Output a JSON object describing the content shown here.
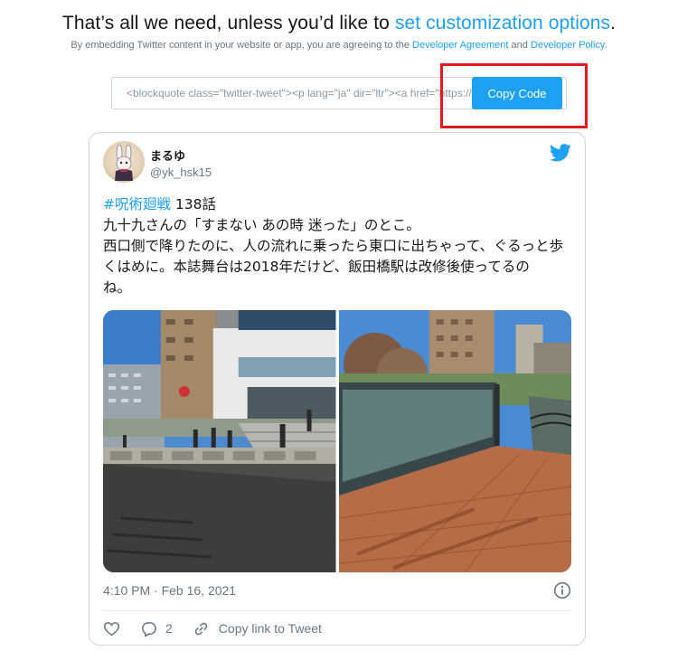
{
  "header": {
    "headline_prefix": "That’s all we need, unless you’d like to ",
    "headline_link": "set customization options",
    "headline_suffix": ".",
    "sub_prefix": "By embedding Twitter content in your website or app, you are agreeing to the ",
    "developer_agreement": "Developer Agreement",
    "sub_and": " and ",
    "developer_policy": "Developer Policy",
    "sub_suffix": "."
  },
  "embed": {
    "code_preview": "<blockquote class=\"twitter-tweet\"><p lang=\"ja\" dir=\"ltr\"><a href=\"https://twitter.com/hashtag/",
    "copy_label": "Copy Code"
  },
  "tweet": {
    "author_name": "まるゆ",
    "author_handle": "@yk_hsk15",
    "hashtag": "#呪術廻戦",
    "hashtag_rest": " 138話",
    "lines": [
      "九十九さんの「すまない あの時 迷った」のとこ。",
      "西口側で降りたのに、人の流れに乗ったら東口に出ちゃって、ぐるっと歩",
      "くはめに。本誌舞台は2018年だけど、飯田橋駅は改修後使ってるの",
      "ね。"
    ],
    "timestamp": "4:10 PM · Feb 16, 2021",
    "reply_count": "2",
    "copy_link_label": "Copy link to Tweet"
  },
  "icons": {
    "twitter_bird": "twitter-bird-icon",
    "info": "info-icon",
    "heart": "heart-icon",
    "reply": "reply-bubble-icon",
    "link": "link-icon"
  },
  "colors": {
    "accent": "#1da1f2",
    "highlight_border": "#e0191f",
    "muted_text": "#657786"
  }
}
